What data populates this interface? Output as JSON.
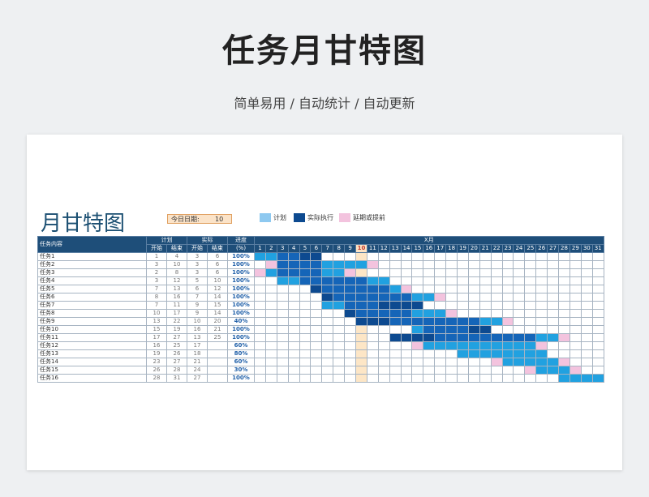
{
  "page": {
    "headline": "任务月甘特图",
    "subline": "简单易用 / 自动统计 / 自动更新"
  },
  "sheet": {
    "title": "月甘特图",
    "today_label": "今日日期:",
    "today_value": "10",
    "legend": [
      {
        "label": "计划",
        "color": "#8ec9f0"
      },
      {
        "label": "实际执行",
        "color": "#0d4a90"
      },
      {
        "label": "延期或提前",
        "color": "#f3c3de"
      }
    ],
    "headers": {
      "task": "任务内容",
      "plan": "计划",
      "actual": "实际",
      "progress": "进度",
      "progress_unit": "(%)",
      "start": "开始",
      "end": "结束",
      "month": "X月"
    },
    "today_day": 10,
    "days": [
      1,
      2,
      3,
      4,
      5,
      6,
      7,
      8,
      9,
      10,
      11,
      12,
      13,
      14,
      15,
      16,
      17,
      18,
      19,
      20,
      21,
      22,
      23,
      24,
      25,
      26,
      27,
      28,
      29,
      30,
      31
    ],
    "tasks": [
      {
        "name": "任务1",
        "ps": "1",
        "pe": "4",
        "as": "3",
        "ae": "6",
        "pct": "100%"
      },
      {
        "name": "任务2",
        "ps": "3",
        "pe": "10",
        "as": "3",
        "ae": "6",
        "pct": "100%"
      },
      {
        "name": "任务3",
        "ps": "2",
        "pe": "8",
        "as": "3",
        "ae": "6",
        "pct": "100%"
      },
      {
        "name": "任务4",
        "ps": "3",
        "pe": "12",
        "as": "5",
        "ae": "10",
        "pct": "100%"
      },
      {
        "name": "任务5",
        "ps": "7",
        "pe": "13",
        "as": "6",
        "ae": "12",
        "pct": "100%"
      },
      {
        "name": "任务6",
        "ps": "8",
        "pe": "16",
        "as": "7",
        "ae": "14",
        "pct": "100%"
      },
      {
        "name": "任务7",
        "ps": "7",
        "pe": "11",
        "as": "9",
        "ae": "15",
        "pct": "100%"
      },
      {
        "name": "任务8",
        "ps": "10",
        "pe": "17",
        "as": "9",
        "ae": "14",
        "pct": "100%"
      },
      {
        "name": "任务9",
        "ps": "13",
        "pe": "22",
        "as": "10",
        "ae": "20",
        "pct": "40%"
      },
      {
        "name": "任务10",
        "ps": "15",
        "pe": "19",
        "as": "16",
        "ae": "21",
        "pct": "100%"
      },
      {
        "name": "任务11",
        "ps": "17",
        "pe": "27",
        "as": "13",
        "ae": "25",
        "pct": "100%"
      },
      {
        "name": "任务12",
        "ps": "16",
        "pe": "25",
        "as": "17",
        "ae": "",
        "pct": "60%"
      },
      {
        "name": "任务13",
        "ps": "19",
        "pe": "26",
        "as": "18",
        "ae": "",
        "pct": "80%"
      },
      {
        "name": "任务14",
        "ps": "23",
        "pe": "27",
        "as": "21",
        "ae": "",
        "pct": "60%"
      },
      {
        "name": "任务15",
        "ps": "26",
        "pe": "28",
        "as": "24",
        "ae": "",
        "pct": "30%"
      },
      {
        "name": "任务16",
        "ps": "28",
        "pe": "31",
        "as": "27",
        "ae": "",
        "pct": "100%"
      }
    ]
  }
}
